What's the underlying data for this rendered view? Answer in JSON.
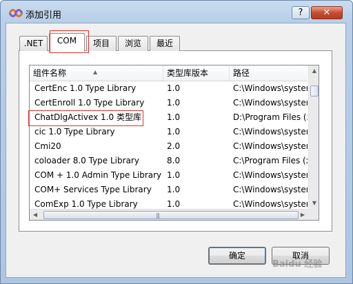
{
  "window": {
    "title": "添加引用",
    "help_label": "?",
    "close_label": "✕"
  },
  "tabs": [
    {
      "label": ".NET",
      "active": false
    },
    {
      "label": "COM",
      "active": true
    },
    {
      "label": "项目",
      "active": false
    },
    {
      "label": "浏览",
      "active": false
    },
    {
      "label": "最近",
      "active": false
    }
  ],
  "list": {
    "columns": [
      "组件名称",
      "类型库版本",
      "路径"
    ],
    "rows": [
      {
        "name": "CertEnc 1.0 Type Library",
        "version": "1.0",
        "path": "C:\\Windows\\systen"
      },
      {
        "name": "CertEnroll 1.0 Type Library",
        "version": "1.0",
        "path": "C:\\Windows\\systen"
      },
      {
        "name": "ChatDlgActivex 1.0 类型库",
        "version": "1.0",
        "path": "D:\\Program Files (x"
      },
      {
        "name": "cic 1.0 Type Library",
        "version": "1.0",
        "path": "C:\\Windows\\systen"
      },
      {
        "name": "Cmi20",
        "version": "2.0",
        "path": "C:\\Windows\\systen"
      },
      {
        "name": "coloader 8.0 Type Library",
        "version": "8.0",
        "path": "C:\\Program Files (x"
      },
      {
        "name": "COM + 1.0 Admin Type Library",
        "version": "1.0",
        "path": "C:\\Windows\\systen"
      },
      {
        "name": "COM+ Services Type Library",
        "version": "1.0",
        "path": "C:\\Windows\\systen"
      },
      {
        "name": "ComExp 1.0 Type Library",
        "version": "1.0",
        "path": "C:\\Windows\\systen"
      }
    ]
  },
  "buttons": {
    "ok": "确定",
    "cancel": "取消"
  },
  "watermark": "Baidu 经验",
  "colors": {
    "highlight_border": "#d9322a",
    "title_gradient": "#b9cfe8"
  }
}
